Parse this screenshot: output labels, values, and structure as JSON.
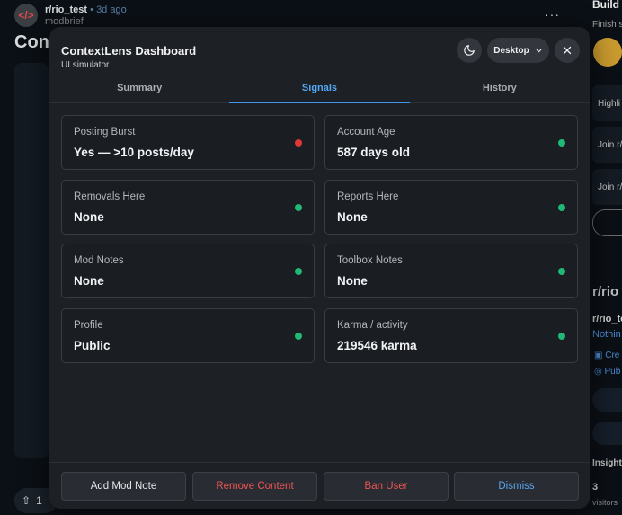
{
  "background": {
    "subreddit": "r/rio_test",
    "age": "3d ago",
    "username": "modbrief",
    "post_title_fragment": "Cont",
    "more_glyph": "···",
    "vote_count": "1",
    "right_panel": {
      "title": "Build s",
      "subtitle": "Finish s",
      "box1": "Highli",
      "box2": "Join r/",
      "box3": "Join r/",
      "heading": "r/rio",
      "community_name": "r/rio_tes",
      "community_desc": "Nothin",
      "meta1": "Cre",
      "meta2": "Pub",
      "insights": "Insight",
      "visitors_count": "3",
      "visitors_label": "visitors"
    }
  },
  "modal": {
    "title": "ContextLens Dashboard",
    "subtitle": "UI simulator",
    "device": "Desktop",
    "tabs": [
      "Summary",
      "Signals",
      "History"
    ],
    "active_tab": "Signals",
    "signals": [
      {
        "label": "Posting Burst",
        "value": "Yes — >10 posts/day",
        "status": "red"
      },
      {
        "label": "Account Age",
        "value": "587 days old",
        "status": "green"
      },
      {
        "label": "Removals Here",
        "value": "None",
        "status": "green"
      },
      {
        "label": "Reports Here",
        "value": "None",
        "status": "green"
      },
      {
        "label": "Mod Notes",
        "value": "None",
        "status": "green"
      },
      {
        "label": "Toolbox Notes",
        "value": "None",
        "status": "green"
      },
      {
        "label": "Profile",
        "value": "Public",
        "status": "green"
      },
      {
        "label": "Karma / activity",
        "value": "219546 karma",
        "status": "green"
      }
    ],
    "actions": {
      "add_note": "Add Mod Note",
      "remove": "Remove Content",
      "ban": "Ban User",
      "dismiss": "Dismiss"
    }
  },
  "colors": {
    "status_red": "#e0373a",
    "status_green": "#1fb874",
    "accent": "#54a8f5",
    "danger_text": "#f05454",
    "dismiss_text": "#5aa6f0",
    "neutral_text": "#e6e8eb"
  },
  "icons": {
    "theme": "moon-icon",
    "device_chevron": "chevron-down-icon",
    "close": "close-icon"
  }
}
